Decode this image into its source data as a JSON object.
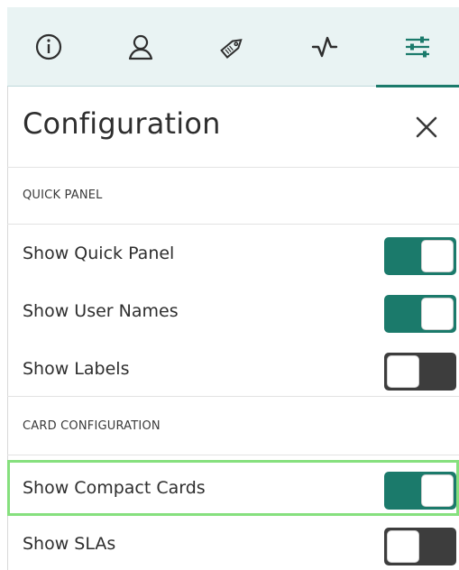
{
  "tabs": [
    {
      "icon": "info-icon",
      "active": false
    },
    {
      "icon": "user-icon",
      "active": false
    },
    {
      "icon": "tag-icon",
      "active": false
    },
    {
      "icon": "activity-icon",
      "active": false
    },
    {
      "icon": "sliders-icon",
      "active": true
    }
  ],
  "panel": {
    "title": "Configuration",
    "close_icon": "close-icon"
  },
  "sections": {
    "quick_panel": {
      "label": "QUICK PANEL",
      "items": [
        {
          "label": "Show Quick Panel",
          "on": true
        },
        {
          "label": "Show User Names",
          "on": true
        },
        {
          "label": "Show Labels",
          "on": false
        }
      ]
    },
    "card_configuration": {
      "label": "CARD CONFIGURATION",
      "items": [
        {
          "label": "Show Compact Cards",
          "on": true
        },
        {
          "label": "Show SLAs",
          "on": false
        }
      ]
    }
  },
  "colors": {
    "accent": "#1b7a6b",
    "toggle_off": "#3d3d3d",
    "tab_bar_bg": "#e9f3f3",
    "highlight": "#86e07e"
  }
}
